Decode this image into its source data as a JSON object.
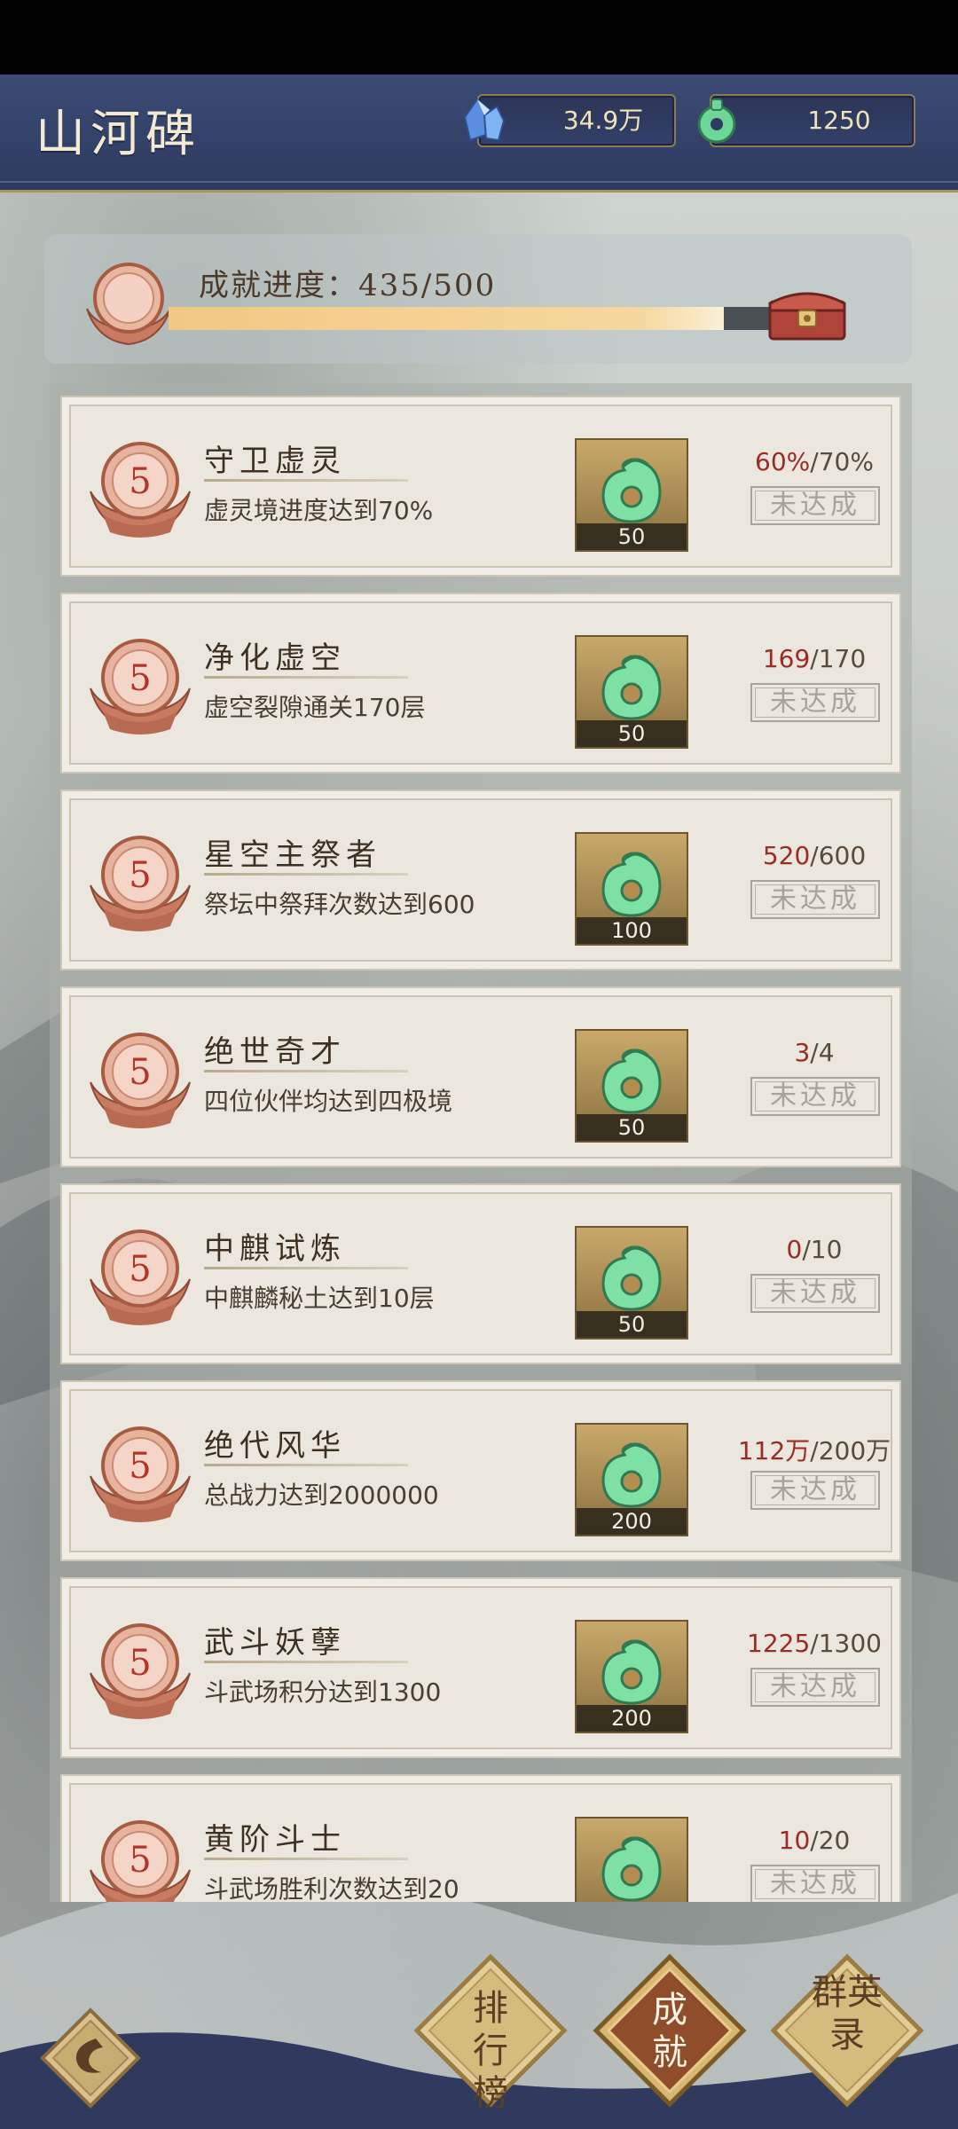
{
  "header": {
    "title": "山河碑",
    "currency1": {
      "icon": "crystal-icon",
      "value": "34.9万"
    },
    "currency2": {
      "icon": "jade-token-icon",
      "value": "1250"
    }
  },
  "progress": {
    "label": "成就进度：",
    "value_text": "435/500",
    "current": 435,
    "total": 500
  },
  "achievements": [
    {
      "level": "5",
      "name": "守卫虚灵",
      "desc": "虚灵境进度达到70%",
      "reward": "50",
      "cur": "60%",
      "target": "/70%",
      "status": "未达成"
    },
    {
      "level": "5",
      "name": "净化虚空",
      "desc": "虚空裂隙通关170层",
      "reward": "50",
      "cur": "169",
      "target": "/170",
      "status": "未达成"
    },
    {
      "level": "5",
      "name": "星空主祭者",
      "desc": "祭坛中祭拜次数达到600",
      "reward": "100",
      "cur": "520",
      "target": "/600",
      "status": "未达成"
    },
    {
      "level": "5",
      "name": "绝世奇才",
      "desc": "四位伙伴均达到四极境",
      "reward": "50",
      "cur": "3",
      "target": "/4",
      "status": "未达成"
    },
    {
      "level": "5",
      "name": "中麒试炼",
      "desc": "中麒麟秘土达到10层",
      "reward": "50",
      "cur": "0",
      "target": "/10",
      "status": "未达成"
    },
    {
      "level": "5",
      "name": "绝代风华",
      "desc": "总战力达到2000000",
      "reward": "200",
      "cur": "112万",
      "target": "/200万",
      "status": "未达成"
    },
    {
      "level": "5",
      "name": "武斗妖孽",
      "desc": "斗武场积分达到1300",
      "reward": "200",
      "cur": "1225",
      "target": "/1300",
      "status": "未达成"
    },
    {
      "level": "5",
      "name": "黄阶斗士",
      "desc": "斗武场胜利次数达到20",
      "reward": "",
      "cur": "10",
      "target": "/20",
      "status": "未达成"
    }
  ],
  "nav": {
    "back_icon": "back-arrow-icon",
    "leaderboard": "排行榜",
    "achievement": "成就",
    "heroes": "群英录"
  }
}
